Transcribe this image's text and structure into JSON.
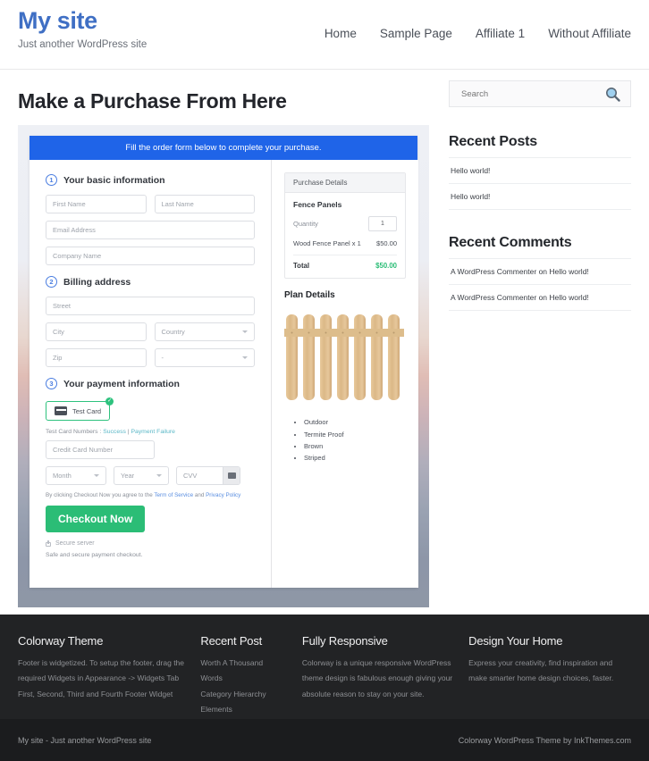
{
  "header": {
    "site_title": "My site",
    "tagline": "Just another WordPress site",
    "nav": [
      {
        "label": "Home"
      },
      {
        "label": "Sample Page"
      },
      {
        "label": "Affiliate 1"
      },
      {
        "label": "Without Affiliate"
      }
    ]
  },
  "main": {
    "page_title": "Make a Purchase From Here",
    "banner": "Fill the order form below to complete your purchase.",
    "steps": {
      "one": {
        "num": "1",
        "label": "Your basic information"
      },
      "two": {
        "num": "2",
        "label": "Billing address"
      },
      "three": {
        "num": "3",
        "label": "Your payment information"
      }
    },
    "fields": {
      "first_name": "First Name",
      "last_name": "Last Name",
      "email": "Email Address",
      "company": "Company Name",
      "street": "Street",
      "city": "City",
      "country": "Country",
      "zip": "Zip",
      "state": "-",
      "card_number": "Credit Card Number",
      "month": "Month",
      "year": "Year",
      "cvv": "CVV"
    },
    "payment": {
      "card_option_label": "Test Card",
      "card_selected_mark": "✓",
      "test_numbers_prefix": "Test Card Numbers : ",
      "test_success": "Success",
      "test_separator": " | ",
      "test_failure": "Payment Failure",
      "terms_prefix": "By clicking Checkout Now you agree to the ",
      "terms_link_1": "Term of Service",
      "terms_middle": " and ",
      "terms_link_2": "Privacy Policy",
      "checkout_label": "Checkout Now",
      "secure_server": "Secure server",
      "safe_note": "Safe and secure payment checkout."
    },
    "purchase_details": {
      "heading": "Purchase Details",
      "product": "Fence Panels",
      "quantity_label": "Quantity",
      "quantity_value": "1",
      "line_item_label": "Wood Fence Panel x 1",
      "line_item_price": "$50.00",
      "total_label": "Total",
      "total_price": "$50.00"
    },
    "plan_details": {
      "heading": "Plan Details",
      "features": [
        "Outdoor",
        "Termite Proof",
        "Brown",
        "Striped"
      ]
    }
  },
  "sidebar": {
    "search_placeholder": "Search",
    "recent_posts": {
      "title": "Recent Posts",
      "items": [
        {
          "label": "Hello world!"
        },
        {
          "label": "Hello world!"
        }
      ]
    },
    "recent_comments": {
      "title": "Recent Comments",
      "items": [
        {
          "label": "A WordPress Commenter on Hello world!"
        },
        {
          "label": "A WordPress Commenter on Hello world!"
        }
      ]
    }
  },
  "footer": {
    "columns": [
      {
        "title": "Colorway Theme",
        "text": "Footer is widgetized. To setup the footer, drag the required Widgets in Appearance -> Widgets Tab First, Second, Third and Fourth Footer Widget"
      },
      {
        "title": "Recent Post",
        "items": [
          "Worth A Thousand Words",
          "Category Hierarchy",
          "Elements"
        ]
      },
      {
        "title": "Fully Responsive",
        "text": "Colorway is a unique responsive WordPress theme design is fabulous enough giving your absolute reason to stay on your site."
      },
      {
        "title": "Design Your Home",
        "text": "Express your creativity, find inspiration and make smarter home design choices, faster."
      }
    ],
    "bar_left": "My site - Just another WordPress site",
    "bar_right": "Colorway WordPress Theme by InkThemes.com"
  },
  "colors": {
    "brand_blue": "#3f6fc4",
    "banner_blue": "#1f64e8",
    "accent_green": "#2bbd76",
    "footer_dark": "#222325",
    "footer_bar": "#1b1c1e"
  }
}
